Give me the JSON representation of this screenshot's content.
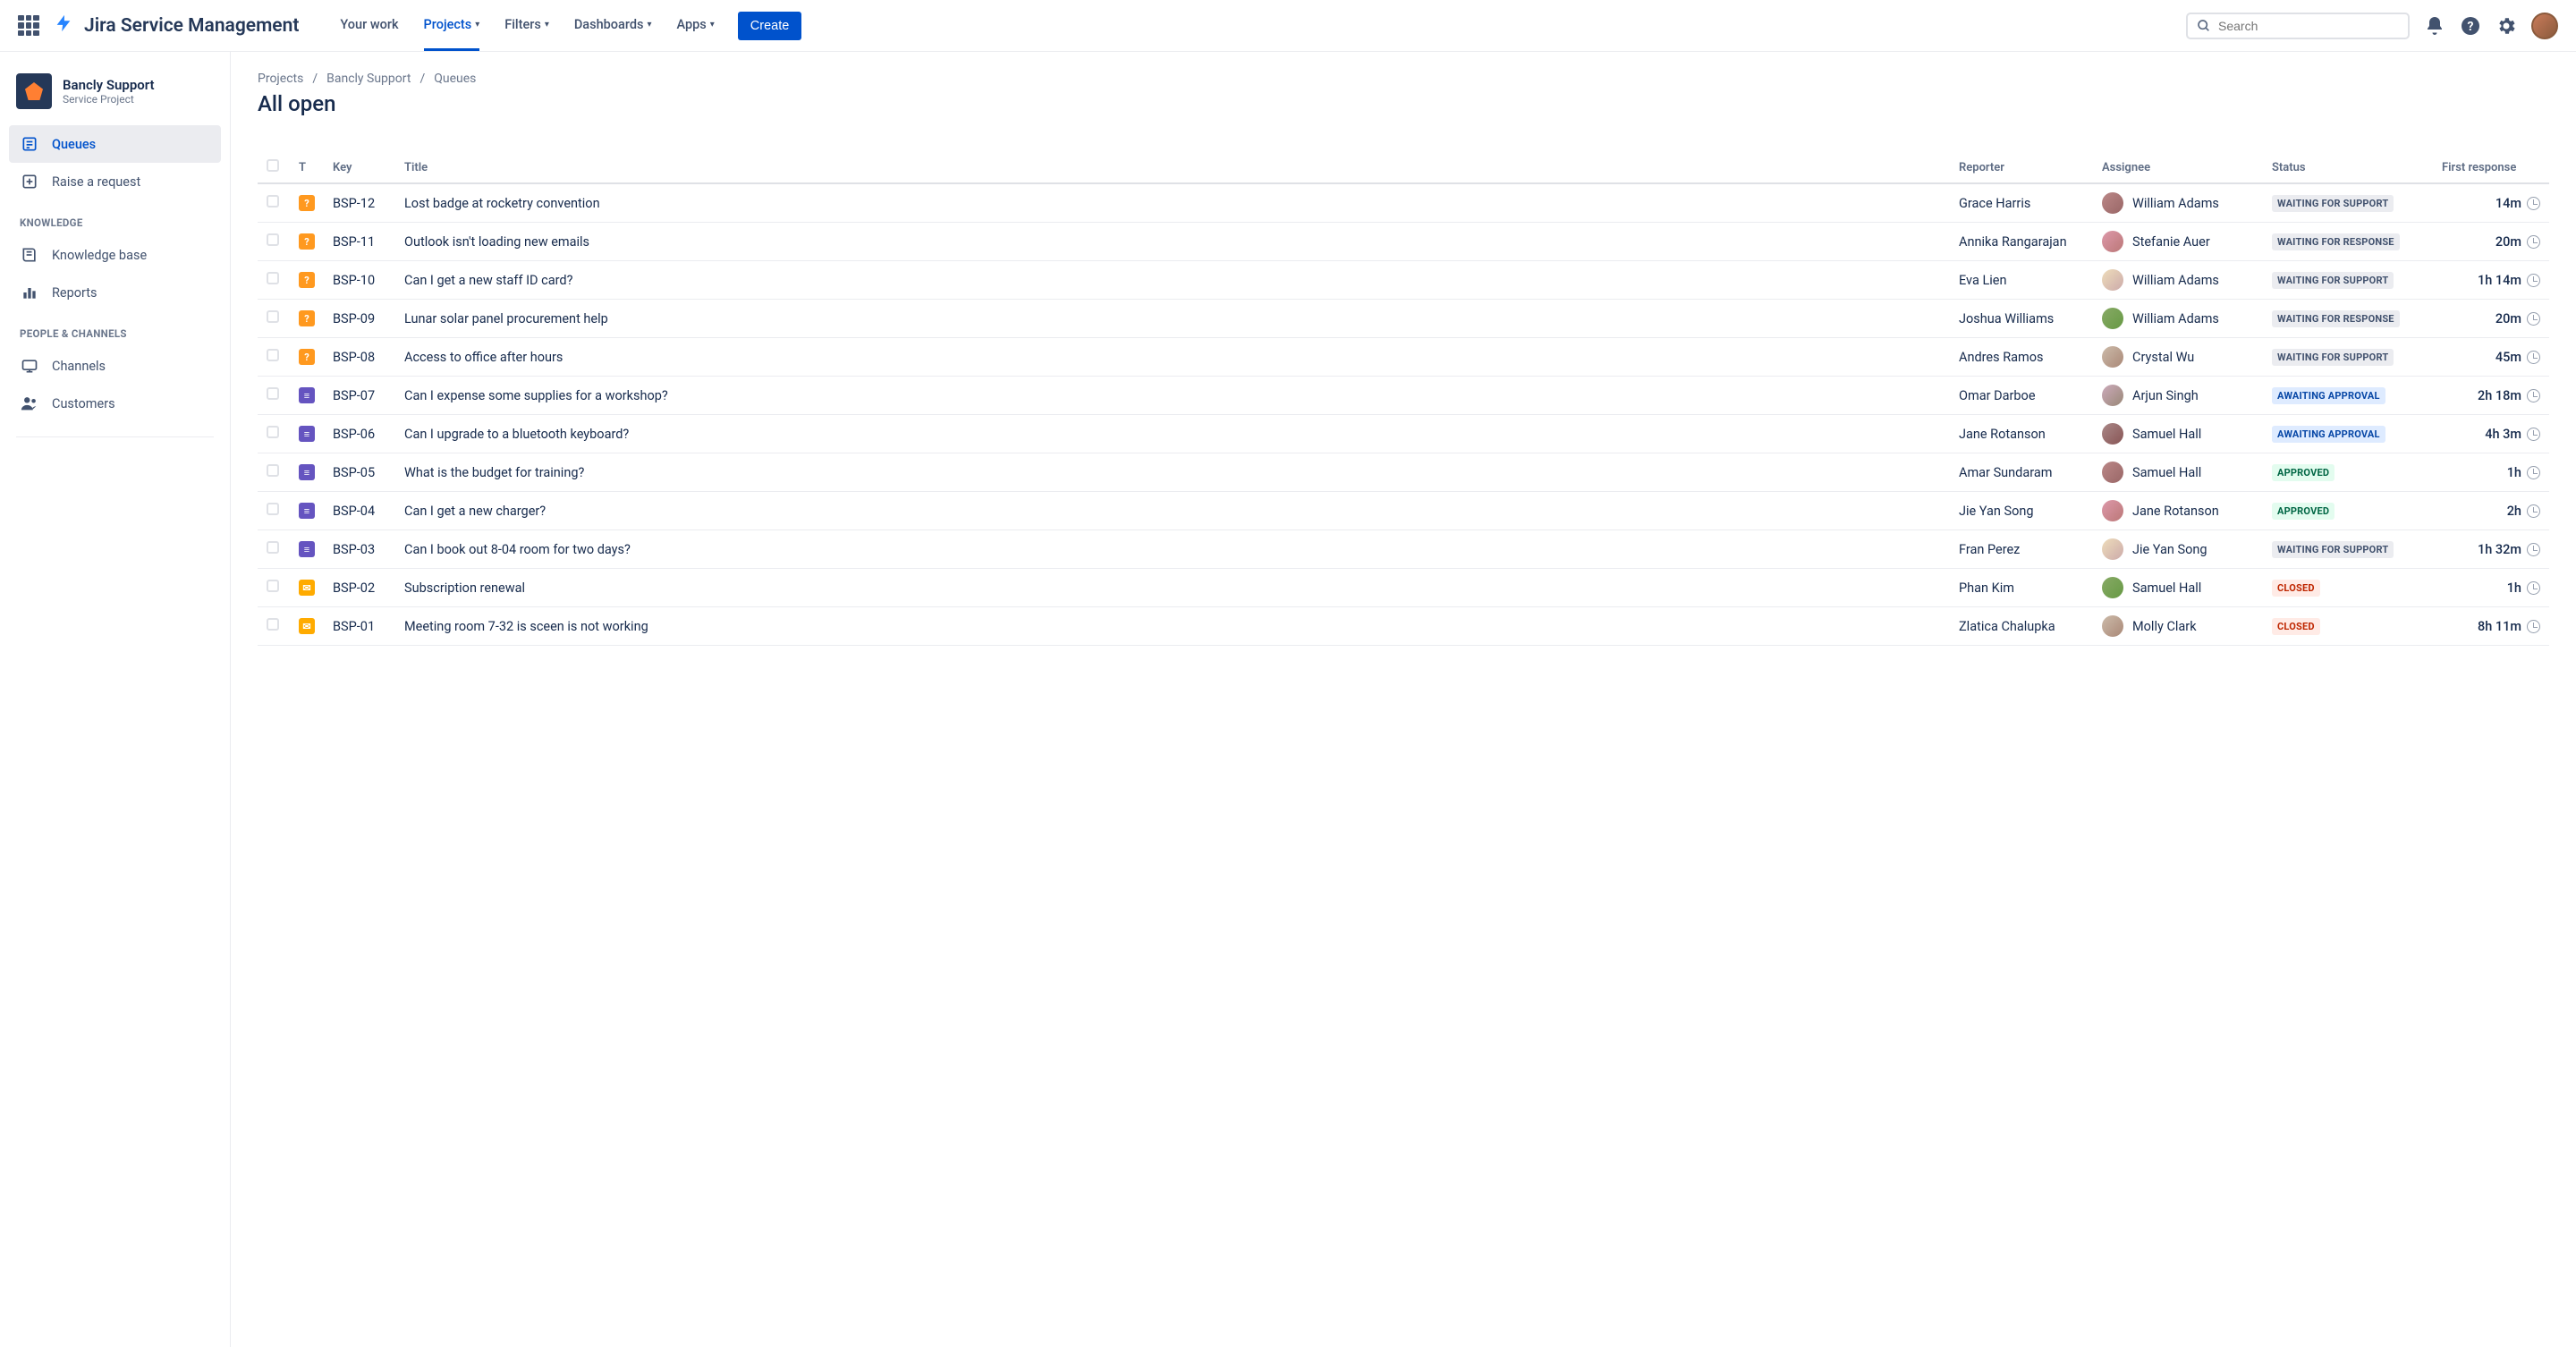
{
  "product": "Jira Service Management",
  "nav": {
    "your_work": "Your work",
    "projects": "Projects",
    "filters": "Filters",
    "dashboards": "Dashboards",
    "apps": "Apps",
    "create": "Create",
    "search_placeholder": "Search"
  },
  "project": {
    "name": "Bancly Support",
    "type": "Service Project"
  },
  "sidebar": {
    "queues": "Queues",
    "raise_request": "Raise a request",
    "knowledge_heading": "KNOWLEDGE",
    "knowledge_base": "Knowledge base",
    "reports": "Reports",
    "people_heading": "PEOPLE & CHANNELS",
    "channels": "Channels",
    "customers": "Customers"
  },
  "breadcrumbs": {
    "projects": "Projects",
    "project": "Bancly Support",
    "section": "Queues"
  },
  "page_title": "All open",
  "columns": {
    "t": "T",
    "key": "Key",
    "title": "Title",
    "reporter": "Reporter",
    "assignee": "Assignee",
    "status": "Status",
    "first_response": "First response"
  },
  "status_labels": {
    "waiting_support": "WAITING FOR SUPPORT",
    "waiting_response": "WAITING FOR RESPONSE",
    "awaiting_approval": "AWAITING APPROVAL",
    "approved": "APPROVED",
    "closed": "CLOSED"
  },
  "tickets": [
    {
      "key": "BSP-12",
      "title": "Lost badge at rocketry convention",
      "reporter": "Grace Harris",
      "assignee": "William Adams",
      "status": "waiting_support",
      "time": "14m",
      "type": "orange"
    },
    {
      "key": "BSP-11",
      "title": "Outlook isn't loading new emails",
      "reporter": "Annika Rangarajan",
      "assignee": "Stefanie Auer",
      "status": "waiting_response",
      "time": "20m",
      "type": "orange"
    },
    {
      "key": "BSP-10",
      "title": "Can I get a new staff ID card?",
      "reporter": "Eva Lien",
      "assignee": "William Adams",
      "status": "waiting_support",
      "time": "1h 14m",
      "type": "orange"
    },
    {
      "key": "BSP-09",
      "title": "Lunar solar panel procurement help",
      "reporter": "Joshua Williams",
      "assignee": "William Adams",
      "status": "waiting_response",
      "time": "20m",
      "type": "orange"
    },
    {
      "key": "BSP-08",
      "title": "Access to office after hours",
      "reporter": "Andres Ramos",
      "assignee": "Crystal Wu",
      "status": "waiting_support",
      "time": "45m",
      "type": "orange"
    },
    {
      "key": "BSP-07",
      "title": "Can I expense some supplies for a workshop?",
      "reporter": "Omar Darboe",
      "assignee": "Arjun Singh",
      "status": "awaiting_approval",
      "time": "2h 18m",
      "type": "purple"
    },
    {
      "key": "BSP-06",
      "title": "Can I upgrade to a bluetooth keyboard?",
      "reporter": "Jane Rotanson",
      "assignee": "Samuel Hall",
      "status": "awaiting_approval",
      "time": "4h 3m",
      "type": "purple"
    },
    {
      "key": "BSP-05",
      "title": "What is the budget for training?",
      "reporter": "Amar Sundaram",
      "assignee": "Samuel Hall",
      "status": "approved",
      "time": "1h",
      "type": "purple"
    },
    {
      "key": "BSP-04",
      "title": "Can I get a new charger?",
      "reporter": "Jie Yan Song",
      "assignee": "Jane Rotanson",
      "status": "approved",
      "time": "2h",
      "type": "purple"
    },
    {
      "key": "BSP-03",
      "title": "Can I book out 8-04 room for two days?",
      "reporter": "Fran Perez",
      "assignee": "Jie Yan Song",
      "status": "waiting_support",
      "time": "1h 32m",
      "type": "purple"
    },
    {
      "key": "BSP-02",
      "title": "Subscription renewal",
      "reporter": "Phan Kim",
      "assignee": "Samuel Hall",
      "status": "closed",
      "time": "1h",
      "type": "yellow"
    },
    {
      "key": "BSP-01",
      "title": "Meeting room 7-32 is sceen is not working",
      "reporter": "Zlatica Chalupka",
      "assignee": "Molly Clark",
      "status": "closed",
      "time": "8h 11m",
      "type": "yellow"
    }
  ]
}
